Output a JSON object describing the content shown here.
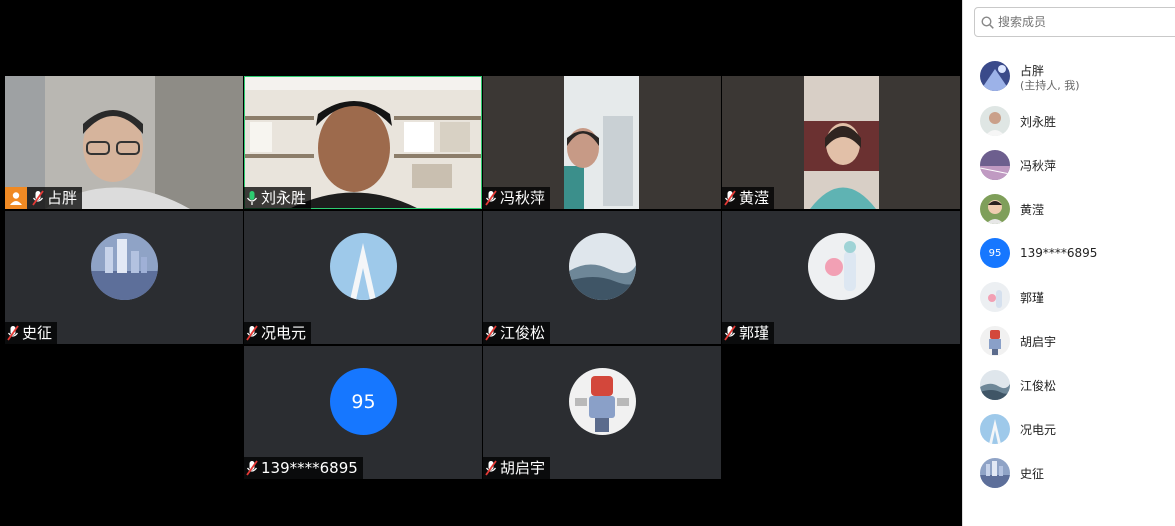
{
  "tiles": [
    {
      "name": "占胖",
      "host": true,
      "muted": true
    },
    {
      "name": "刘永胜",
      "host": false,
      "muted": false,
      "active": true
    },
    {
      "name": "冯秋萍",
      "muted": true
    },
    {
      "name": "黄滢",
      "muted": true
    },
    {
      "name": "史征",
      "muted": true
    },
    {
      "name": "况电元",
      "muted": true
    },
    {
      "name": "江俊松",
      "muted": true
    },
    {
      "name": "郭瑾",
      "muted": true
    },
    {
      "name": "139****6895",
      "avatar_text": "95",
      "muted": true
    },
    {
      "name": "胡启宇",
      "muted": true
    }
  ],
  "panel": {
    "search_placeholder": "搜索成员",
    "members": [
      {
        "name": "占胖",
        "sub": "(主持人, 我)"
      },
      {
        "name": "刘永胜"
      },
      {
        "name": "冯秋萍"
      },
      {
        "name": "黄滢"
      },
      {
        "name": "139****6895",
        "avatar_text": "95"
      },
      {
        "name": "郭瑾"
      },
      {
        "name": "胡启宇"
      },
      {
        "name": "江俊松"
      },
      {
        "name": "况电元"
      },
      {
        "name": "史征"
      }
    ]
  },
  "colors": {
    "accent": "#1677ff",
    "host_badge": "#f08a24",
    "active_border": "#2ecc71",
    "mic_muted": "#e53935",
    "mic_on": "#2ecc71"
  }
}
